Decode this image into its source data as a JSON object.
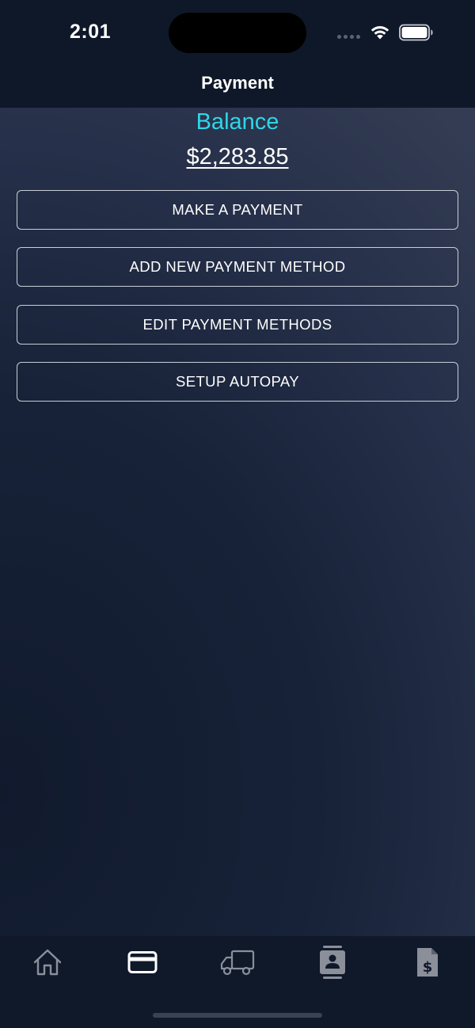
{
  "status_bar": {
    "time": "2:01",
    "icons": [
      "signal-dots-icon",
      "wifi-icon",
      "battery-icon"
    ]
  },
  "header": {
    "title": "Payment"
  },
  "balance": {
    "label": "Balance",
    "amount": "$2,283.85",
    "label_color": "#2fd6e8"
  },
  "actions": [
    {
      "label": "MAKE A PAYMENT"
    },
    {
      "label": "ADD NEW PAYMENT METHOD"
    },
    {
      "label": "EDIT PAYMENT METHODS"
    },
    {
      "label": "SETUP AUTOPAY"
    }
  ],
  "tab_bar": {
    "tabs": [
      {
        "icon": "home-icon",
        "active": false
      },
      {
        "icon": "credit-card-icon",
        "active": true
      },
      {
        "icon": "delivery-truck-icon",
        "active": false
      },
      {
        "icon": "contact-card-icon",
        "active": false
      },
      {
        "icon": "invoice-dollar-icon",
        "active": false
      }
    ],
    "active_color": "#ffffff",
    "inactive_color": "#8a8f9a"
  }
}
